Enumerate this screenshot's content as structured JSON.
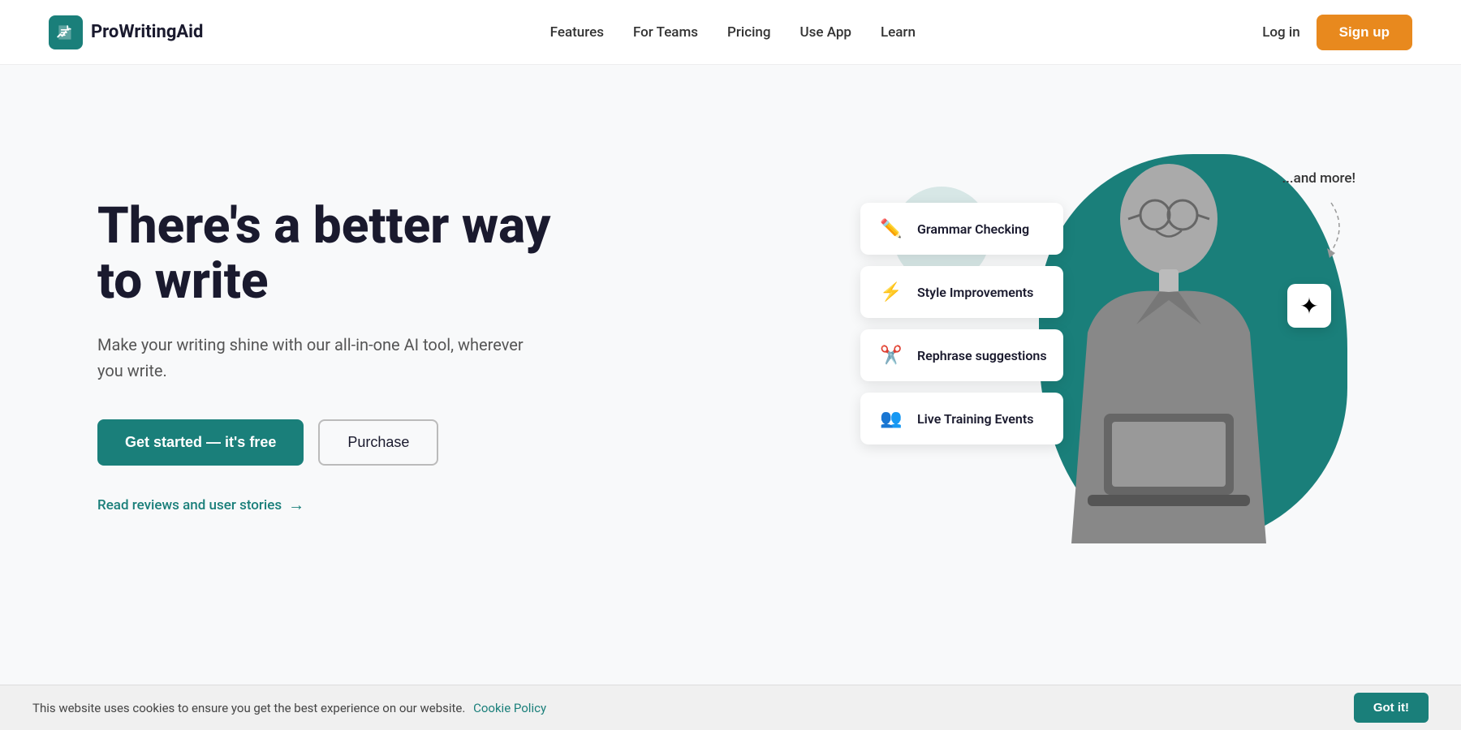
{
  "navbar": {
    "logo_text": "ProWritingAid",
    "links": [
      {
        "label": "Features",
        "id": "features"
      },
      {
        "label": "For Teams",
        "id": "for-teams"
      },
      {
        "label": "Pricing",
        "id": "pricing"
      },
      {
        "label": "Use App",
        "id": "use-app"
      },
      {
        "label": "Learn",
        "id": "learn"
      }
    ],
    "login_label": "Log in",
    "signup_label": "Sign up"
  },
  "hero": {
    "title": "There's a better way to write",
    "subtitle": "Make your writing shine with our all-in-one AI tool, wherever you write.",
    "cta_primary": "Get started  —  it's free",
    "cta_secondary": "Purchase",
    "reviews_link": "Read reviews and user stories",
    "and_more": "...and more!"
  },
  "features": [
    {
      "label": "Grammar Checking",
      "icon": "✏️"
    },
    {
      "label": "Style Improvements",
      "icon": "⚡"
    },
    {
      "label": "Rephrase suggestions",
      "icon": "✂️"
    },
    {
      "label": "Live Training Events",
      "icon": "👤"
    }
  ],
  "cookie": {
    "text": "This website uses cookies to ensure you get the best experience on our website.",
    "link_text": "Cookie Policy",
    "btn_label": "Got it!"
  }
}
